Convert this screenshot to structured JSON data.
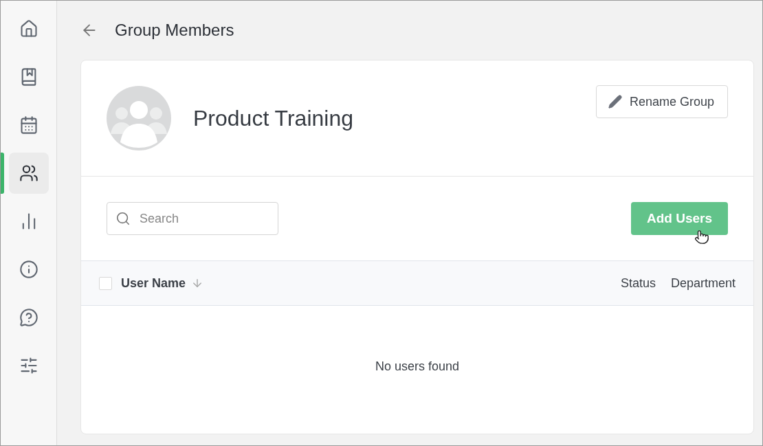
{
  "sidebar": {
    "items": [
      {
        "selected": false
      },
      {
        "selected": false
      },
      {
        "selected": false
      },
      {
        "selected": true
      },
      {
        "selected": false
      },
      {
        "selected": false
      },
      {
        "selected": false
      },
      {
        "selected": false
      }
    ]
  },
  "header": {
    "title": "Group Members"
  },
  "group": {
    "name": "Product Training",
    "rename_button": "Rename Group"
  },
  "toolbar": {
    "search": {
      "placeholder": "Search"
    },
    "add_button": "Add Users"
  },
  "table": {
    "select_all": {
      "checked": false
    },
    "columns": [
      {
        "label": "User Name",
        "sorted": true
      },
      {
        "label": "Status",
        "sorted": false
      },
      {
        "label": "Department",
        "sorted": false
      }
    ],
    "empty_message": "No users found"
  }
}
